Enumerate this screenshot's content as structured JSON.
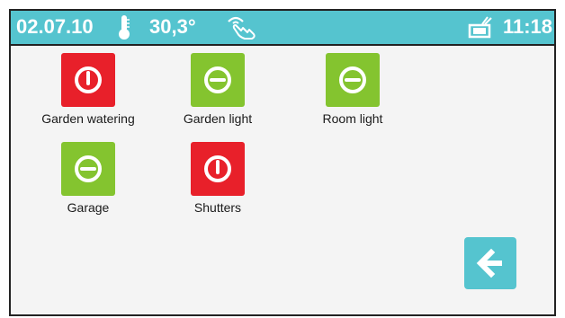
{
  "status_bar": {
    "date": "02.07.10",
    "temperature": "30,3°",
    "time": "11:18",
    "icons": [
      "thermometer-icon",
      "hand-icon",
      "tray-icon"
    ],
    "background_color": "#55c4cf"
  },
  "devices": [
    {
      "label": "Garden watering",
      "state": "off",
      "icon": "power-icon",
      "color": "#e8202a"
    },
    {
      "label": "Garden light",
      "state": "dimmed",
      "icon": "minus-icon",
      "color": "#84c42f"
    },
    {
      "label": "Room light",
      "state": "dimmed",
      "icon": "minus-icon",
      "color": "#84c42f"
    },
    {
      "label": "Garage",
      "state": "dimmed",
      "icon": "minus-icon",
      "color": "#84c42f"
    },
    {
      "label": "Shutters",
      "state": "off",
      "icon": "power-icon",
      "color": "#e8202a"
    }
  ],
  "navigation": {
    "back_icon": "arrow-left-icon",
    "back_color": "#55c4cf"
  }
}
